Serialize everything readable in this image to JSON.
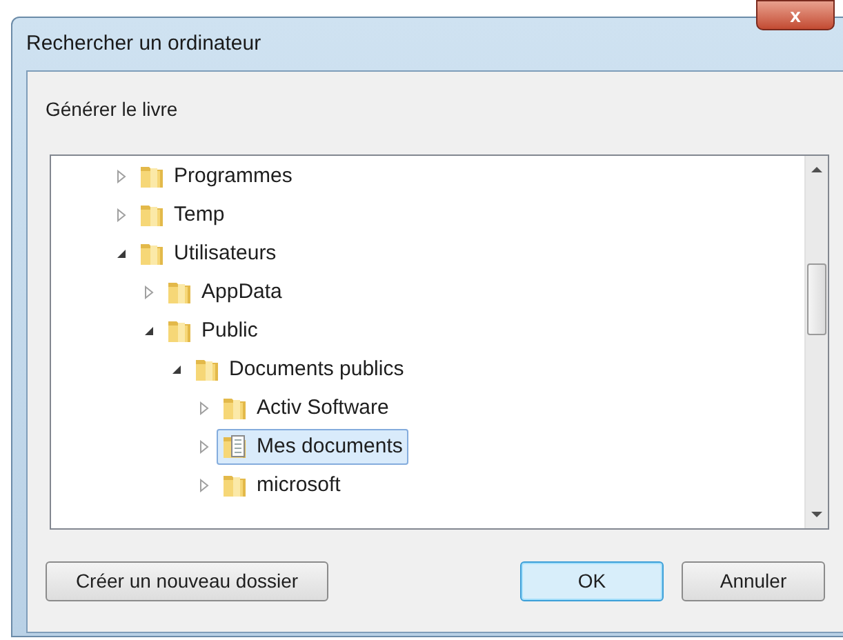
{
  "window": {
    "title": "Rechercher un ordinateur",
    "close_label": "x"
  },
  "description": "Générer le livre",
  "tree": [
    {
      "label": "Programmes",
      "expanded": false,
      "selected": false,
      "kind": "folder"
    },
    {
      "label": "Temp",
      "expanded": false,
      "selected": false,
      "kind": "folder"
    },
    {
      "label": "Utilisateurs",
      "expanded": true,
      "selected": false,
      "kind": "folder",
      "children": [
        {
          "label": "AppData",
          "expanded": false,
          "selected": false,
          "kind": "folder"
        },
        {
          "label": "Public",
          "expanded": true,
          "selected": false,
          "kind": "folder",
          "children": [
            {
              "label": "Documents publics",
              "expanded": true,
              "selected": false,
              "kind": "folder",
              "children": [
                {
                  "label": "Activ Software",
                  "expanded": false,
                  "selected": false,
                  "kind": "folder"
                },
                {
                  "label": "Mes documents",
                  "expanded": false,
                  "selected": true,
                  "kind": "documents"
                },
                {
                  "label": "microsoft",
                  "expanded": false,
                  "selected": false,
                  "kind": "folder"
                }
              ]
            }
          ]
        }
      ]
    }
  ],
  "buttons": [
    {
      "label": "Créer un nouveau dossier",
      "kind": "secondary"
    },
    {
      "label": "OK",
      "kind": "default"
    },
    {
      "label": "Annuler",
      "kind": "normal"
    }
  ]
}
